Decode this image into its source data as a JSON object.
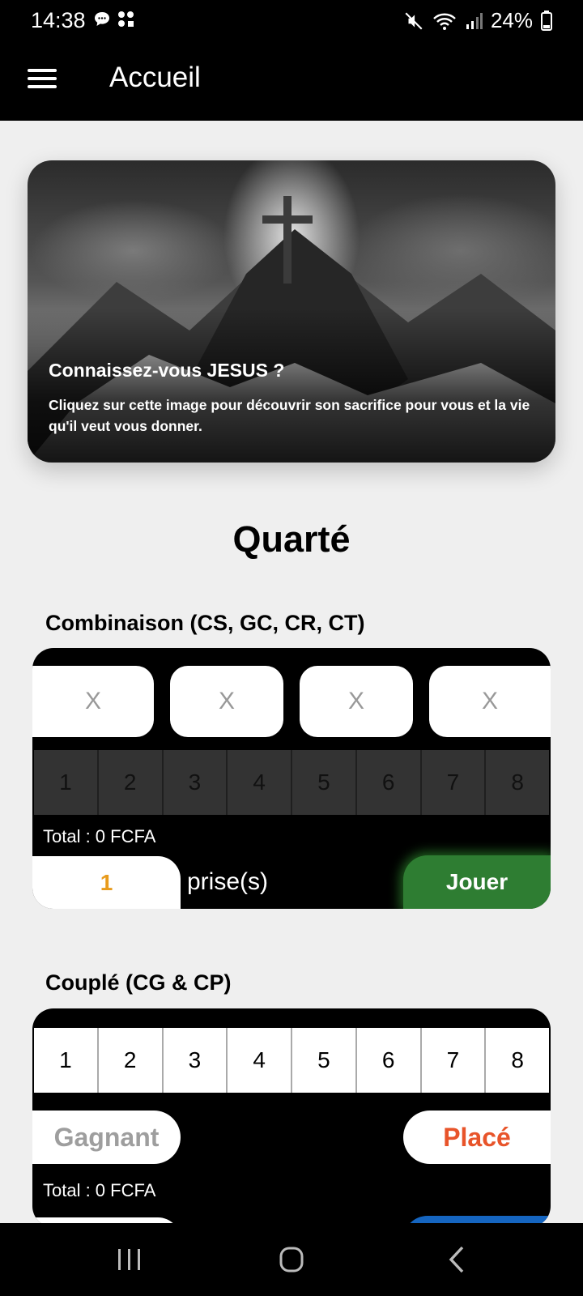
{
  "status_bar": {
    "time": "14:38",
    "battery": "24%",
    "icons": [
      "chat-bubble-icon",
      "dots-icon",
      "mute-icon",
      "wifi-icon",
      "signal-icon",
      "battery-icon"
    ]
  },
  "app_bar": {
    "title": "Accueil",
    "menu_icon": "hamburger-icon"
  },
  "banner": {
    "title": "Connaissez-vous JESUS ?",
    "subtitle": "Cliquez sur cette image pour découvrir son sacrifice pour vous et la vie qu'il veut vous donner."
  },
  "heading": "Quarté",
  "quarte": {
    "label": "Combinaison (CS, GC, CR, CT)",
    "slots": [
      "X",
      "X",
      "X",
      "X"
    ],
    "numbers": [
      "1",
      "2",
      "3",
      "4",
      "5",
      "6",
      "7",
      "8"
    ],
    "total": "Total : 0 FCFA",
    "prise_value": "1",
    "prise_label": "prise(s)",
    "play_button": "Jouer"
  },
  "couple": {
    "label": "Couplé (CG & CP)",
    "numbers": [
      "1",
      "2",
      "3",
      "4",
      "5",
      "6",
      "7",
      "8"
    ],
    "gagnant": "Gagnant",
    "place": "Placé",
    "total": "Total : 0 FCFA"
  },
  "colors": {
    "bar_background": "#000000",
    "page_background": "#efefef",
    "play_green": "#2e7d32",
    "prise_orange": "#e89b1c",
    "place_red": "#e8542a",
    "gagnant_gray": "#9e9e9e",
    "accent_blue": "#1565c0"
  },
  "nav_bar": [
    "recents-icon",
    "home-icon",
    "back-icon"
  ]
}
